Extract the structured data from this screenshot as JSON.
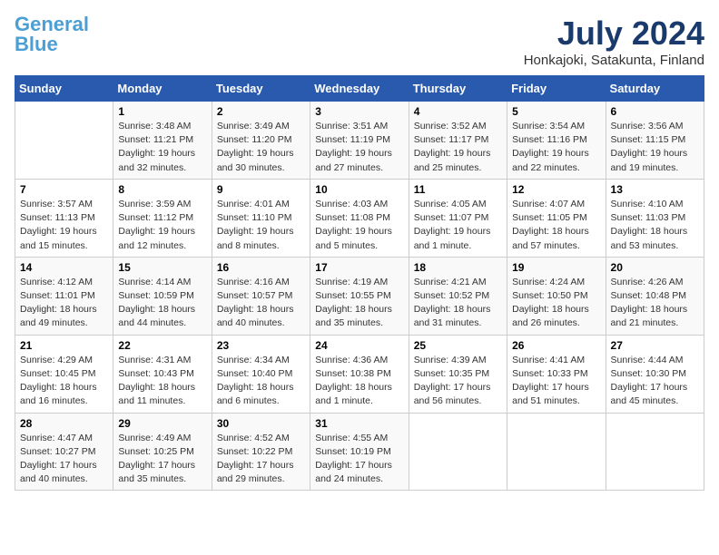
{
  "header": {
    "logo_line1": "General",
    "logo_line2": "Blue",
    "month": "July 2024",
    "location": "Honkajoki, Satakunta, Finland"
  },
  "weekdays": [
    "Sunday",
    "Monday",
    "Tuesday",
    "Wednesday",
    "Thursday",
    "Friday",
    "Saturday"
  ],
  "weeks": [
    [
      {
        "day": "",
        "sunrise": "",
        "sunset": "",
        "daylight": ""
      },
      {
        "day": "1",
        "sunrise": "3:48 AM",
        "sunset": "11:21 PM",
        "daylight": "19 hours and 32 minutes."
      },
      {
        "day": "2",
        "sunrise": "3:49 AM",
        "sunset": "11:20 PM",
        "daylight": "19 hours and 30 minutes."
      },
      {
        "day": "3",
        "sunrise": "3:51 AM",
        "sunset": "11:19 PM",
        "daylight": "19 hours and 27 minutes."
      },
      {
        "day": "4",
        "sunrise": "3:52 AM",
        "sunset": "11:17 PM",
        "daylight": "19 hours and 25 minutes."
      },
      {
        "day": "5",
        "sunrise": "3:54 AM",
        "sunset": "11:16 PM",
        "daylight": "19 hours and 22 minutes."
      },
      {
        "day": "6",
        "sunrise": "3:56 AM",
        "sunset": "11:15 PM",
        "daylight": "19 hours and 19 minutes."
      }
    ],
    [
      {
        "day": "7",
        "sunrise": "3:57 AM",
        "sunset": "11:13 PM",
        "daylight": "19 hours and 15 minutes."
      },
      {
        "day": "8",
        "sunrise": "3:59 AM",
        "sunset": "11:12 PM",
        "daylight": "19 hours and 12 minutes."
      },
      {
        "day": "9",
        "sunrise": "4:01 AM",
        "sunset": "11:10 PM",
        "daylight": "19 hours and 8 minutes."
      },
      {
        "day": "10",
        "sunrise": "4:03 AM",
        "sunset": "11:08 PM",
        "daylight": "19 hours and 5 minutes."
      },
      {
        "day": "11",
        "sunrise": "4:05 AM",
        "sunset": "11:07 PM",
        "daylight": "19 hours and 1 minute."
      },
      {
        "day": "12",
        "sunrise": "4:07 AM",
        "sunset": "11:05 PM",
        "daylight": "18 hours and 57 minutes."
      },
      {
        "day": "13",
        "sunrise": "4:10 AM",
        "sunset": "11:03 PM",
        "daylight": "18 hours and 53 minutes."
      }
    ],
    [
      {
        "day": "14",
        "sunrise": "4:12 AM",
        "sunset": "11:01 PM",
        "daylight": "18 hours and 49 minutes."
      },
      {
        "day": "15",
        "sunrise": "4:14 AM",
        "sunset": "10:59 PM",
        "daylight": "18 hours and 44 minutes."
      },
      {
        "day": "16",
        "sunrise": "4:16 AM",
        "sunset": "10:57 PM",
        "daylight": "18 hours and 40 minutes."
      },
      {
        "day": "17",
        "sunrise": "4:19 AM",
        "sunset": "10:55 PM",
        "daylight": "18 hours and 35 minutes."
      },
      {
        "day": "18",
        "sunrise": "4:21 AM",
        "sunset": "10:52 PM",
        "daylight": "18 hours and 31 minutes."
      },
      {
        "day": "19",
        "sunrise": "4:24 AM",
        "sunset": "10:50 PM",
        "daylight": "18 hours and 26 minutes."
      },
      {
        "day": "20",
        "sunrise": "4:26 AM",
        "sunset": "10:48 PM",
        "daylight": "18 hours and 21 minutes."
      }
    ],
    [
      {
        "day": "21",
        "sunrise": "4:29 AM",
        "sunset": "10:45 PM",
        "daylight": "18 hours and 16 minutes."
      },
      {
        "day": "22",
        "sunrise": "4:31 AM",
        "sunset": "10:43 PM",
        "daylight": "18 hours and 11 minutes."
      },
      {
        "day": "23",
        "sunrise": "4:34 AM",
        "sunset": "10:40 PM",
        "daylight": "18 hours and 6 minutes."
      },
      {
        "day": "24",
        "sunrise": "4:36 AM",
        "sunset": "10:38 PM",
        "daylight": "18 hours and 1 minute."
      },
      {
        "day": "25",
        "sunrise": "4:39 AM",
        "sunset": "10:35 PM",
        "daylight": "17 hours and 56 minutes."
      },
      {
        "day": "26",
        "sunrise": "4:41 AM",
        "sunset": "10:33 PM",
        "daylight": "17 hours and 51 minutes."
      },
      {
        "day": "27",
        "sunrise": "4:44 AM",
        "sunset": "10:30 PM",
        "daylight": "17 hours and 45 minutes."
      }
    ],
    [
      {
        "day": "28",
        "sunrise": "4:47 AM",
        "sunset": "10:27 PM",
        "daylight": "17 hours and 40 minutes."
      },
      {
        "day": "29",
        "sunrise": "4:49 AM",
        "sunset": "10:25 PM",
        "daylight": "17 hours and 35 minutes."
      },
      {
        "day": "30",
        "sunrise": "4:52 AM",
        "sunset": "10:22 PM",
        "daylight": "17 hours and 29 minutes."
      },
      {
        "day": "31",
        "sunrise": "4:55 AM",
        "sunset": "10:19 PM",
        "daylight": "17 hours and 24 minutes."
      },
      {
        "day": "",
        "sunrise": "",
        "sunset": "",
        "daylight": ""
      },
      {
        "day": "",
        "sunrise": "",
        "sunset": "",
        "daylight": ""
      },
      {
        "day": "",
        "sunrise": "",
        "sunset": "",
        "daylight": ""
      }
    ]
  ]
}
